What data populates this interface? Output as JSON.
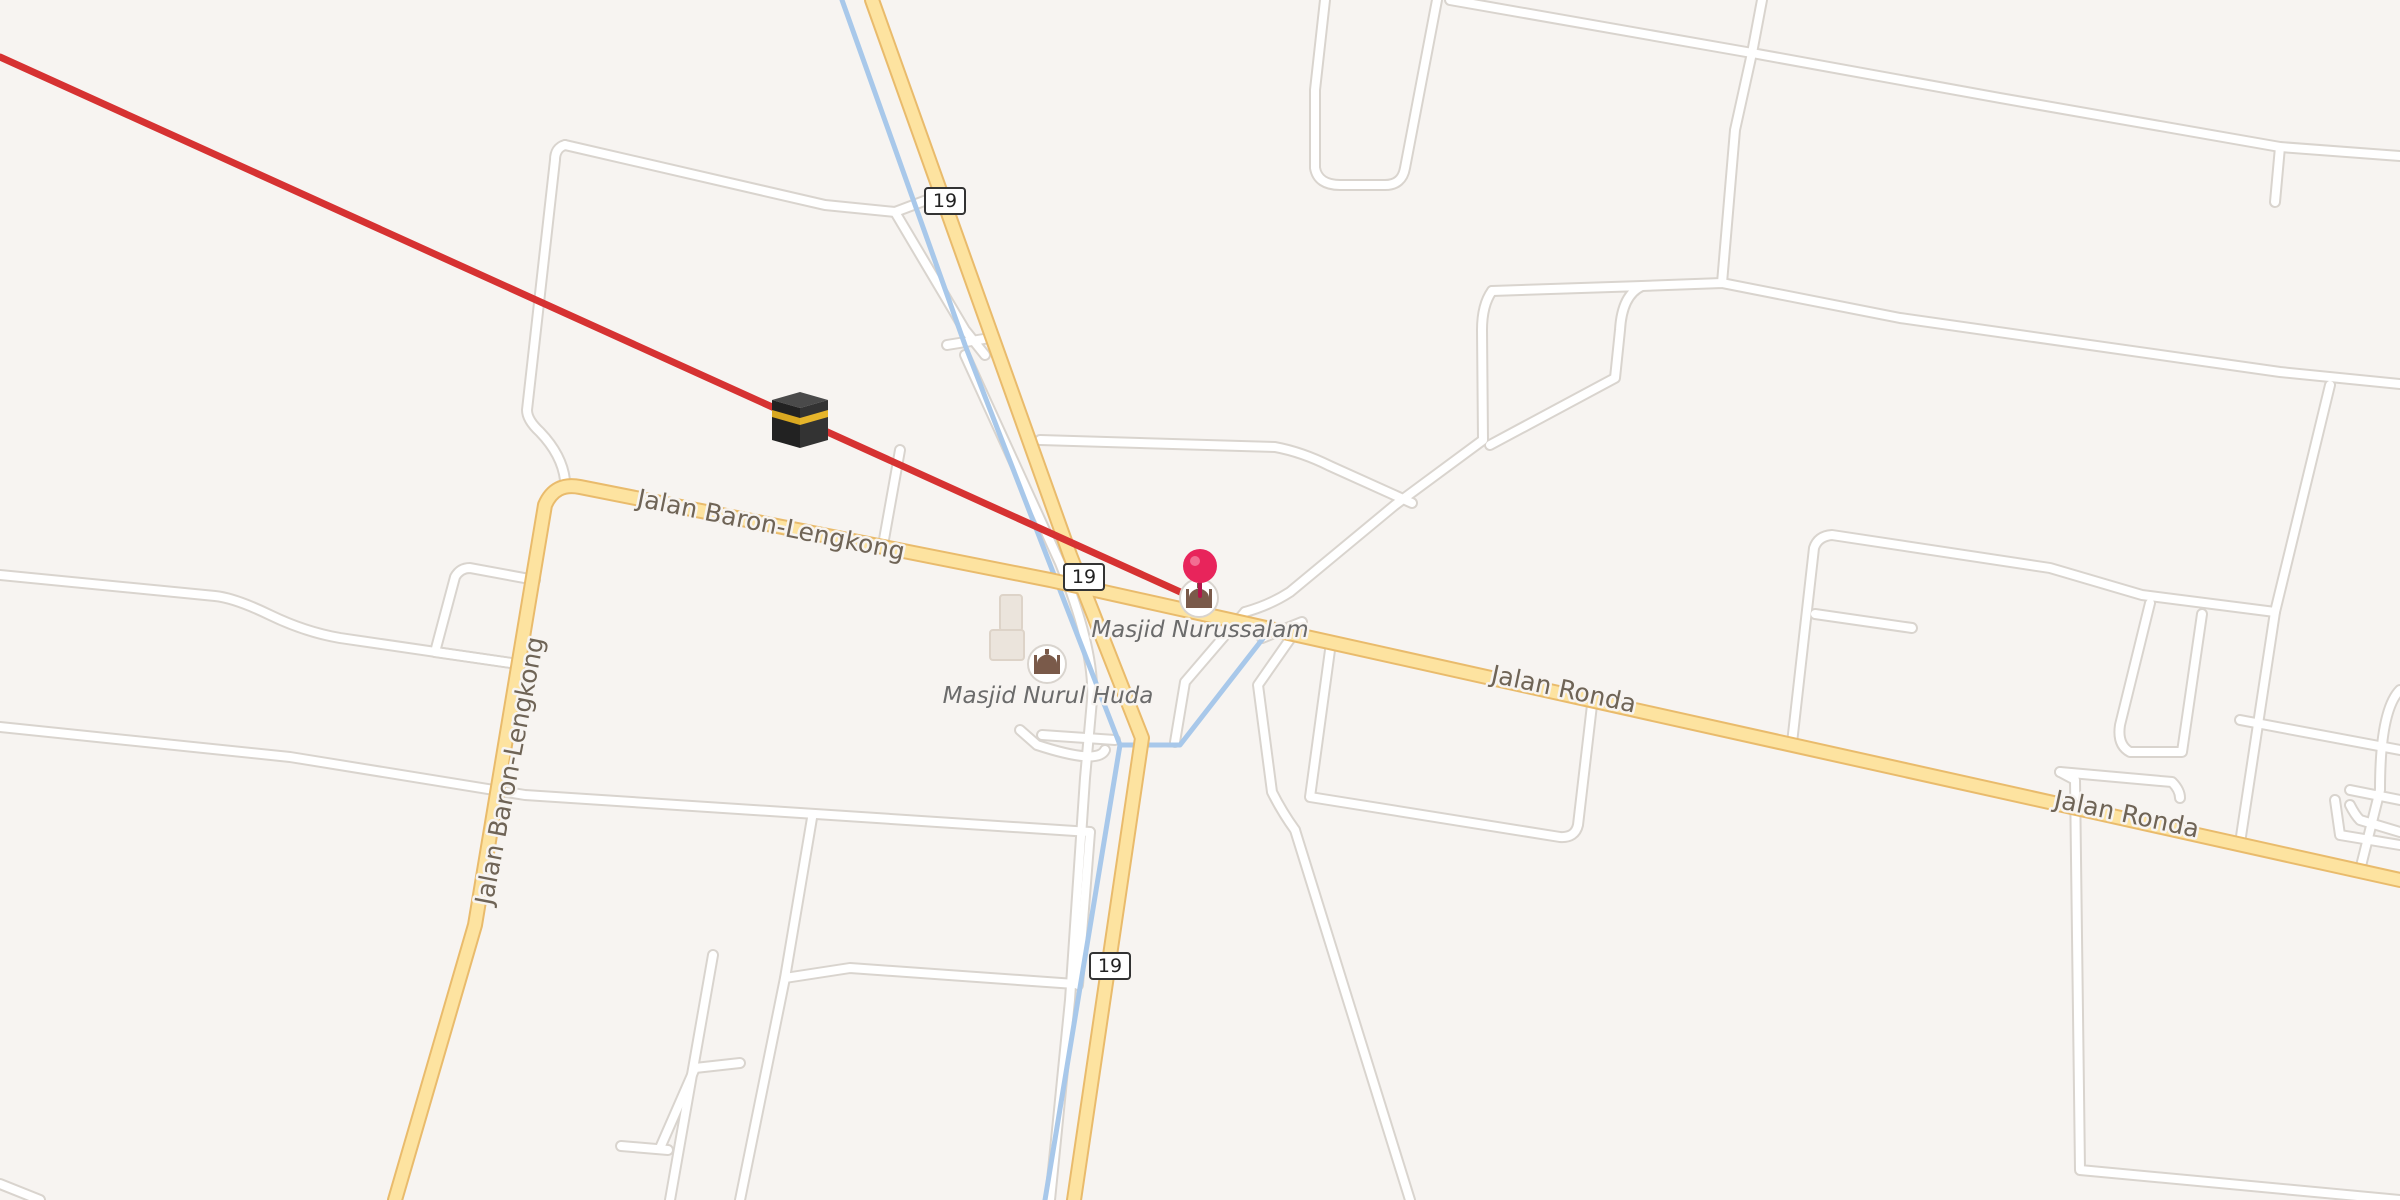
{
  "map": {
    "roads": {
      "primary_color": "#fde3a0",
      "primary_casing": "#e9bb6c",
      "minor_color": "#ffffff",
      "minor_casing": "#d9d4ce",
      "water_color": "#a8c8ea"
    },
    "route_line_color": "#d63232",
    "pin_color": "#e8245b",
    "street_labels": {
      "baron_lengkong_1": "Jalan Baron-Lengkong",
      "baron_lengkong_2": "Jalan Baron-Lengkong",
      "ronda_1": "Jalan Ronda",
      "ronda_2": "Jalan Ronda"
    },
    "route_shields": [
      "19",
      "19",
      "19"
    ],
    "pois": {
      "nurussalam": {
        "name": "Masjid Nurussalam",
        "icon": "mosque-icon"
      },
      "nurul_huda": {
        "name": "Masjid Nurul Huda",
        "icon": "mosque-icon"
      }
    },
    "qibla_marker": {
      "icon": "kaaba-icon"
    },
    "selected_pin": {
      "icon": "map-pin-icon"
    }
  }
}
